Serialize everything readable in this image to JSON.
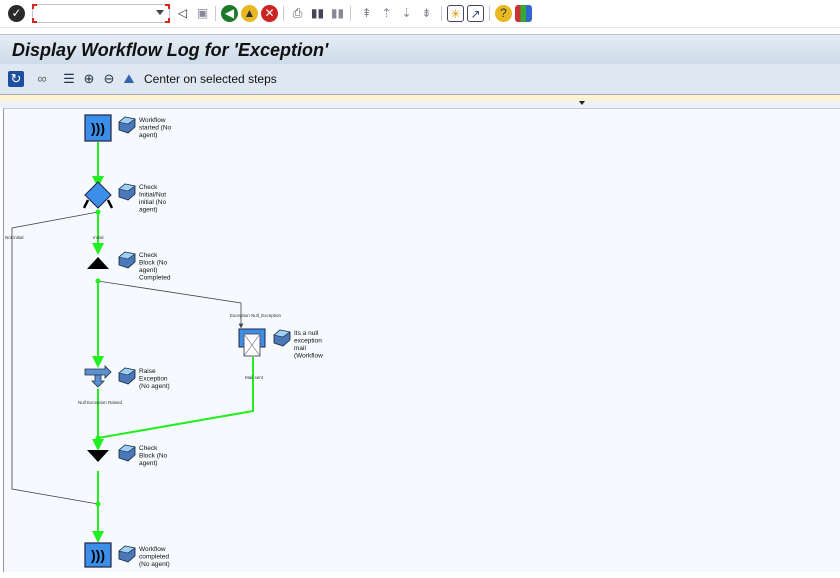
{
  "system_toolbar": {
    "command_field": {
      "value": "",
      "placeholder": ""
    }
  },
  "title": "Display Workflow Log for 'Exception'",
  "app_toolbar": {
    "center_label": "Center on selected steps"
  },
  "diagram": {
    "nodes": [
      {
        "label": [
          "Workflow",
          "started (No",
          "agent)"
        ]
      },
      {
        "label": [
          "Check",
          "Initial/Not",
          "initial (No",
          "agent)"
        ]
      },
      {
        "label": [
          "Check",
          "Block (No",
          "agent)",
          "Completed"
        ]
      },
      {
        "label": [
          "Raise",
          "Exception",
          "(No agent)"
        ]
      },
      {
        "label": [
          "Its a null",
          "exception",
          "mail",
          "(Workflow"
        ]
      },
      {
        "label": [
          "Check",
          "Block (No",
          "agent)"
        ]
      },
      {
        "label": [
          "Workflow",
          "completed",
          "(No agent)"
        ]
      }
    ],
    "edge_labels": {
      "not_initial": "Not initial",
      "initial": "Initial",
      "exception": "Exception Null_Exception",
      "mail_sent": "Mail sent",
      "raised": "Null Exception Raised"
    },
    "colors": {
      "active": "#22ee22",
      "inactive": "#333333",
      "node_blue": "#3b8fe8"
    }
  }
}
